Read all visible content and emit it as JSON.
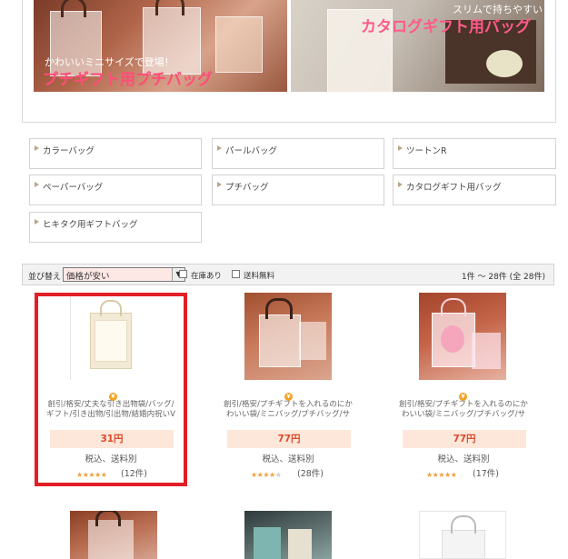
{
  "banners": [
    {
      "subtitle": "かわいいミニサイズで登場！",
      "title": "プチギフト用プチバッグ",
      "title_color": "#ff4d7a"
    },
    {
      "subtitle": "スリムで持ちやすい",
      "title": "カタログギフト用バッグ",
      "title_color": "#ff5a8a"
    }
  ],
  "categories": [
    "カラーバッグ",
    "パールバッグ",
    "ツートンR",
    "ペーパーバッグ",
    "プチバッグ",
    "カタログギフト用バッグ",
    "ヒキタク用ギフトバッグ"
  ],
  "toolbar": {
    "sort_label": "並び替え",
    "sort_value": "価格が安い",
    "filter_in_stock": "在庫あり",
    "filter_free_shipping": "送料無料",
    "result_count": "1件 〜 28件 (全 28件)"
  },
  "products": [
    {
      "desc_line1": "創引/格安/丈夫な引き出物袋/バッグ/",
      "desc_line2": "ギフト/引き出物/引出物/結婚内祝いV",
      "price": "31円",
      "tax": "税込、送料別",
      "rating": 4.5,
      "reviews": "(12件)",
      "medal": "¥"
    },
    {
      "desc_line1": "創引/格安/プチギフトを入れるのにか",
      "desc_line2": "わいい袋/ミニバッグ/プチバッグ/サ",
      "price": "77円",
      "tax": "税込、送料別",
      "rating": 4,
      "reviews": "(28件)",
      "medal": "¥"
    },
    {
      "desc_line1": "創引/格安/プチギフトを入れるのにか",
      "desc_line2": "わいい袋/ミニバッグ/プチバッグ/サ",
      "price": "77円",
      "tax": "税込、送料別",
      "rating": 4.5,
      "reviews": "(17件)",
      "medal": "¥"
    }
  ],
  "colors": {
    "highlight": "#e21e26",
    "price": "#d94a2b",
    "price_bg": "#fde7da",
    "star": "#f0a03a"
  }
}
